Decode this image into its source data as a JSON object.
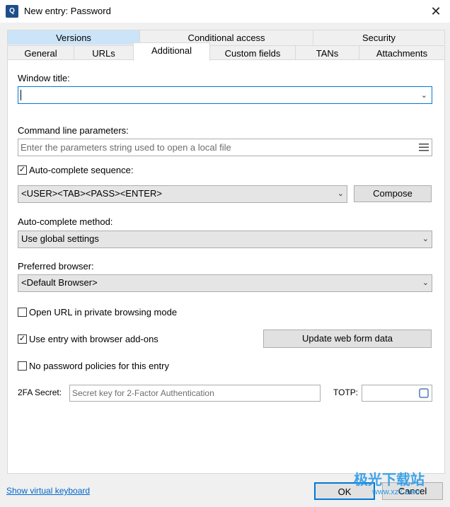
{
  "window": {
    "title": "New entry: Password",
    "app_icon": "app-logo",
    "close_glyph": "✕"
  },
  "tabs_row1": [
    {
      "label": "Versions"
    },
    {
      "label": "Conditional access"
    },
    {
      "label": "Security"
    }
  ],
  "tabs_row2": [
    {
      "label": "General"
    },
    {
      "label": "URLs"
    },
    {
      "label": "Additional"
    },
    {
      "label": "Custom fields"
    },
    {
      "label": "TANs"
    },
    {
      "label": "Attachments"
    }
  ],
  "form": {
    "window_title_label": "Window title:",
    "window_title_value": "",
    "cmd_label": "Command line parameters:",
    "cmd_placeholder": "Enter the parameters string used to open a local file",
    "autocomplete_seq_label": "Auto-complete sequence:",
    "autocomplete_seq_checked": true,
    "autocomplete_seq_value": "<USER><TAB><PASS><ENTER>",
    "compose_label": "Compose",
    "autocomplete_method_label": "Auto-complete method:",
    "autocomplete_method_value": "Use global settings",
    "browser_label": "Preferred browser:",
    "browser_value": "<Default Browser>",
    "private_label": "Open URL in private browsing mode",
    "private_checked": false,
    "addons_label": "Use entry with browser add-ons",
    "addons_checked": true,
    "update_webform_label": "Update web form data",
    "nopolicy_label": "No password policies for this entry",
    "nopolicy_checked": false,
    "twofa_label": "2FA Secret:",
    "twofa_placeholder": "Secret key for 2-Factor Authentication",
    "totp_label": "TOTP:"
  },
  "footer": {
    "keyboard_link": "Show virtual keyboard",
    "ok_label": "OK",
    "cancel_label": "Cancel",
    "watermark_brand": "极光下载站",
    "watermark_url": "www.xz7.com"
  }
}
